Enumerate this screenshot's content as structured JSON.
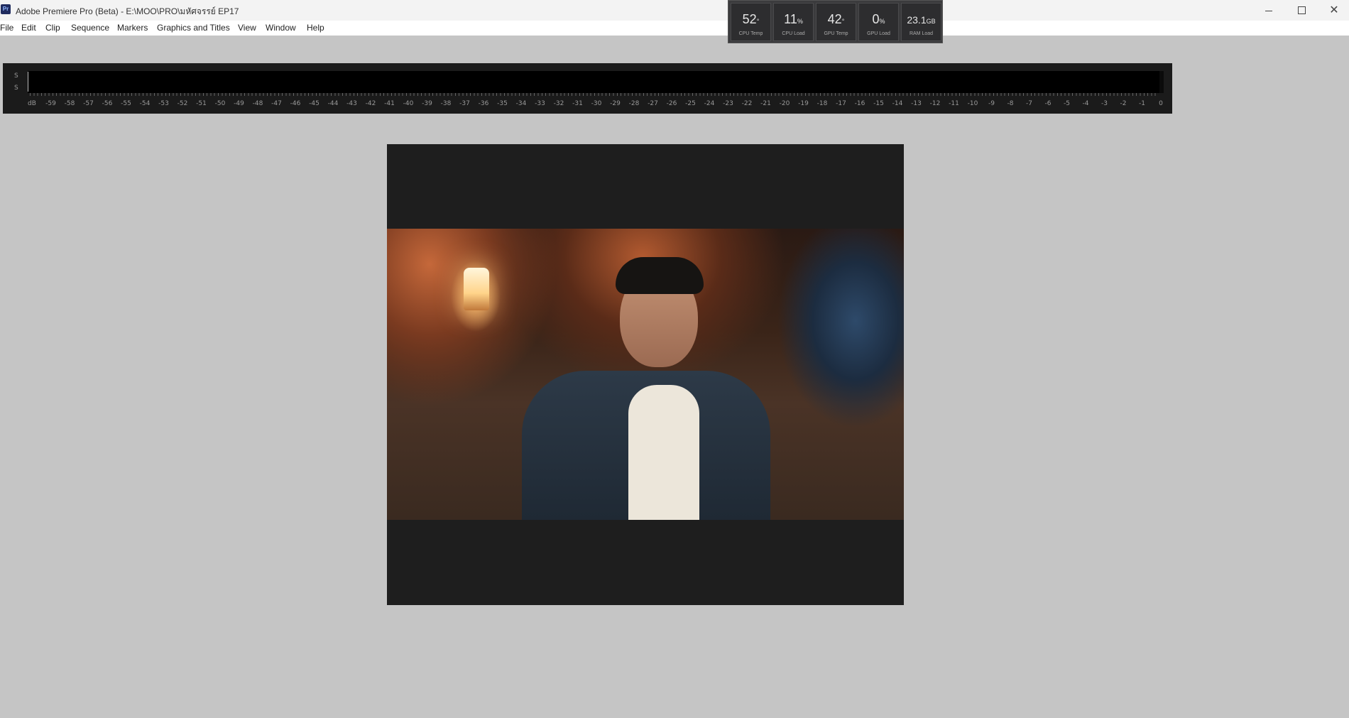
{
  "window": {
    "app_icon_text": "Pr",
    "title": "Adobe Premiere Pro (Beta) - E:\\MOO\\PRO\\มหัศจรรย์ EP17",
    "minimize_icon": "minimize-icon",
    "maximize_icon": "maximize-icon",
    "close_icon": "close-icon"
  },
  "menu": {
    "items": [
      "File",
      "Edit",
      "Clip",
      "Sequence",
      "Markers",
      "Graphics and Titles",
      "View",
      "Window",
      "Help"
    ]
  },
  "hardware_monitor": [
    {
      "value": "52",
      "unit": "°",
      "label": "CPU Temp"
    },
    {
      "value": "11",
      "unit": "%",
      "label": "CPU Load"
    },
    {
      "value": "42",
      "unit": "°",
      "label": "GPU Temp"
    },
    {
      "value": "0",
      "unit": "%",
      "label": "GPU Load"
    },
    {
      "value": "23.1",
      "unit": "GB",
      "label": "RAM Load"
    }
  ],
  "audio_meter": {
    "channels": [
      "S",
      "S"
    ],
    "scale": [
      "dB",
      "-59",
      "-58",
      "-57",
      "-56",
      "-55",
      "-54",
      "-53",
      "-52",
      "-51",
      "-50",
      "-49",
      "-48",
      "-47",
      "-46",
      "-45",
      "-44",
      "-43",
      "-42",
      "-41",
      "-40",
      "-39",
      "-38",
      "-37",
      "-36",
      "-35",
      "-34",
      "-33",
      "-32",
      "-31",
      "-30",
      "-29",
      "-28",
      "-27",
      "-26",
      "-25",
      "-24",
      "-23",
      "-22",
      "-21",
      "-20",
      "-19",
      "-18",
      "-17",
      "-16",
      "-15",
      "-14",
      "-13",
      "-12",
      "-11",
      "-10",
      "-9",
      "-8",
      "-7",
      "-6",
      "-5",
      "-4",
      "-3",
      "-2",
      "-1",
      "0"
    ]
  },
  "program_monitor": {
    "frame_content": "video-frame"
  }
}
